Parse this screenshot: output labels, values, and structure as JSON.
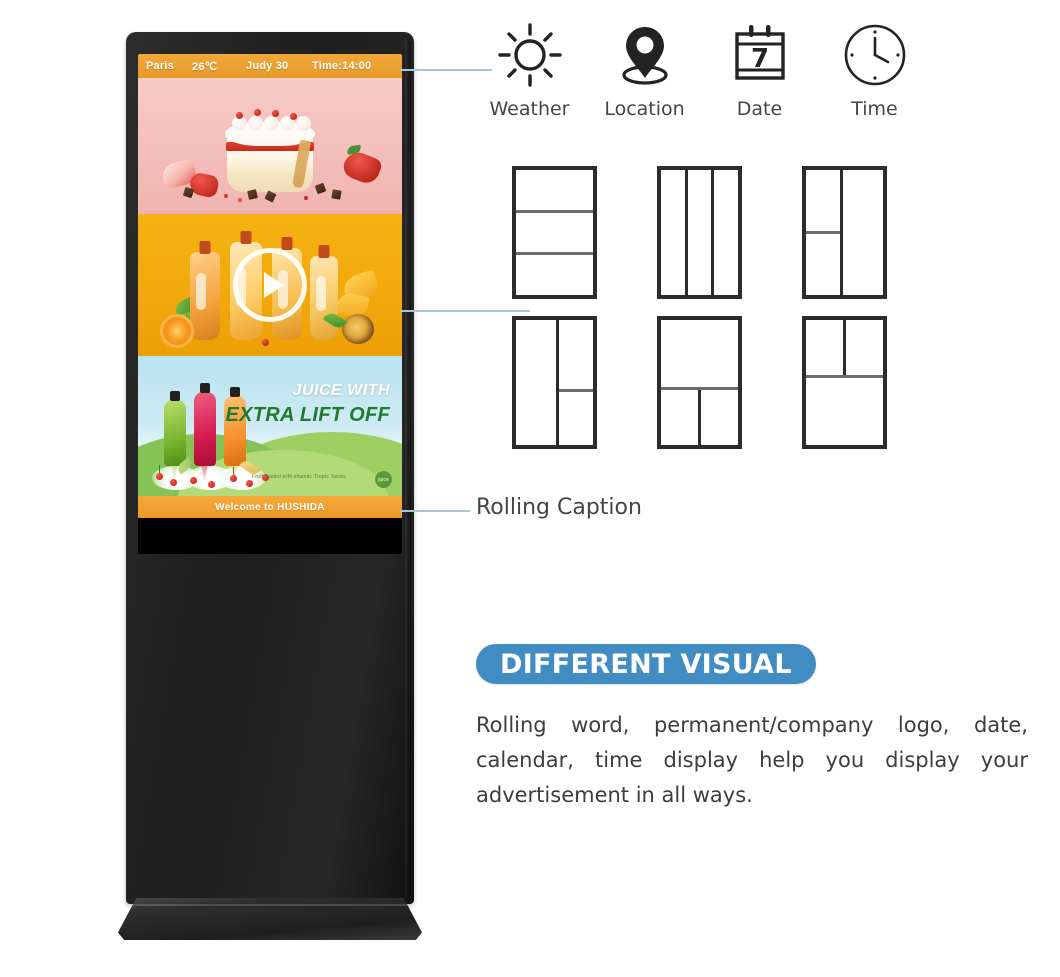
{
  "kiosk": {
    "status_bar": {
      "city": "Paris",
      "temperature": "26℃",
      "date": "Judy 30",
      "time": "Time:14:00"
    },
    "panels": {
      "cake": {
        "name": "strawberry-cake-advertisement"
      },
      "video": {
        "name": "juice-bottles-video-advertisement",
        "play_icon": "play-icon"
      },
      "hills": {
        "title_line1": "JUICE WITH",
        "title_line2": "EXTRA LIFT OFF",
        "subtitle": "Fruit loaded with vitamin. Tropic Juices",
        "logo_text": "juice"
      }
    },
    "rolling_caption": "Welcome to HUSHIDA"
  },
  "features": [
    {
      "icon": "sun-icon",
      "label": "Weather"
    },
    {
      "icon": "map-pin-icon",
      "label": "Location"
    },
    {
      "icon": "calendar-icon",
      "label": "Date",
      "calendar_day": "7"
    },
    {
      "icon": "clock-icon",
      "label": "Time"
    }
  ],
  "layouts": [
    {
      "name": "three-rows",
      "description": "Three stacked horizontal zones"
    },
    {
      "name": "three-columns",
      "description": "Three vertical columns"
    },
    {
      "name": "left-split-two-rows-right-full",
      "description": "Left column split in two rows, right column full height"
    },
    {
      "name": "left-full-right-split-two-rows",
      "description": "Left column full height, right column split in two rows"
    },
    {
      "name": "top-full-bottom-two-columns",
      "description": "Top full width, bottom split in two columns"
    },
    {
      "name": "top-two-columns-bottom-full",
      "description": "Top split in two columns, bottom full width"
    }
  ],
  "callouts": {
    "rolling_caption_label": "Rolling Caption"
  },
  "headline": "DIFFERENT VISUAL",
  "body": "Rolling word, permanent/company logo, date, calendar, time display help you display your advertisement in all ways.",
  "colors": {
    "accent_blue": "#428cc4",
    "connector_blue": "#a9c6d6",
    "status_orange": "#e89a2a",
    "caption_orange": "#ec9a25",
    "panel_pink": "#f4bfbb",
    "panel_yellow": "#f2a90c",
    "panel_sky": "#cdeaf3",
    "kiosk_black": "#1e1e1e"
  }
}
